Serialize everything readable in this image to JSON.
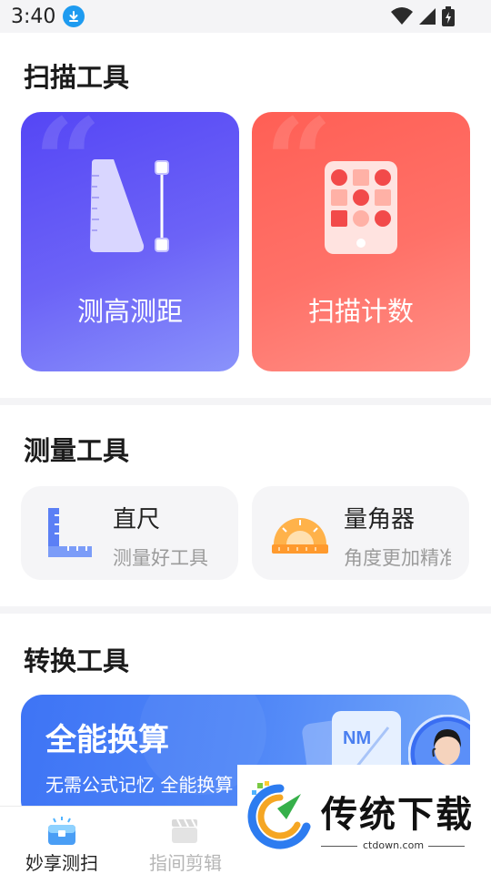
{
  "status_bar": {
    "time": "3:40"
  },
  "sections": {
    "scan": {
      "title": "扫描工具"
    },
    "measure": {
      "title": "测量工具"
    },
    "convert": {
      "title": "转换工具"
    }
  },
  "scan_cards": [
    {
      "label": "测高测距",
      "icon": "height-distance-icon",
      "color": "#5a4ff6"
    },
    {
      "label": "扫描计数",
      "icon": "scan-count-icon",
      "color": "#ff665d"
    }
  ],
  "measure_cards": [
    {
      "title": "直尺",
      "subtitle": "测量好工具",
      "icon": "ruler-icon"
    },
    {
      "title": "量角器",
      "subtitle": "角度更加精准",
      "icon": "protractor-icon"
    }
  ],
  "banner": {
    "title": "全能换算",
    "subtitle": "无需公式记忆 全能换算",
    "badge": "NM"
  },
  "tabs": [
    {
      "label": "妙享测扫",
      "icon": "toolbox-icon",
      "active": true
    },
    {
      "label": "指间剪辑",
      "icon": "clapper-icon",
      "active": false
    }
  ],
  "watermark": {
    "text": "传统下载",
    "url": "ctdown.com"
  }
}
